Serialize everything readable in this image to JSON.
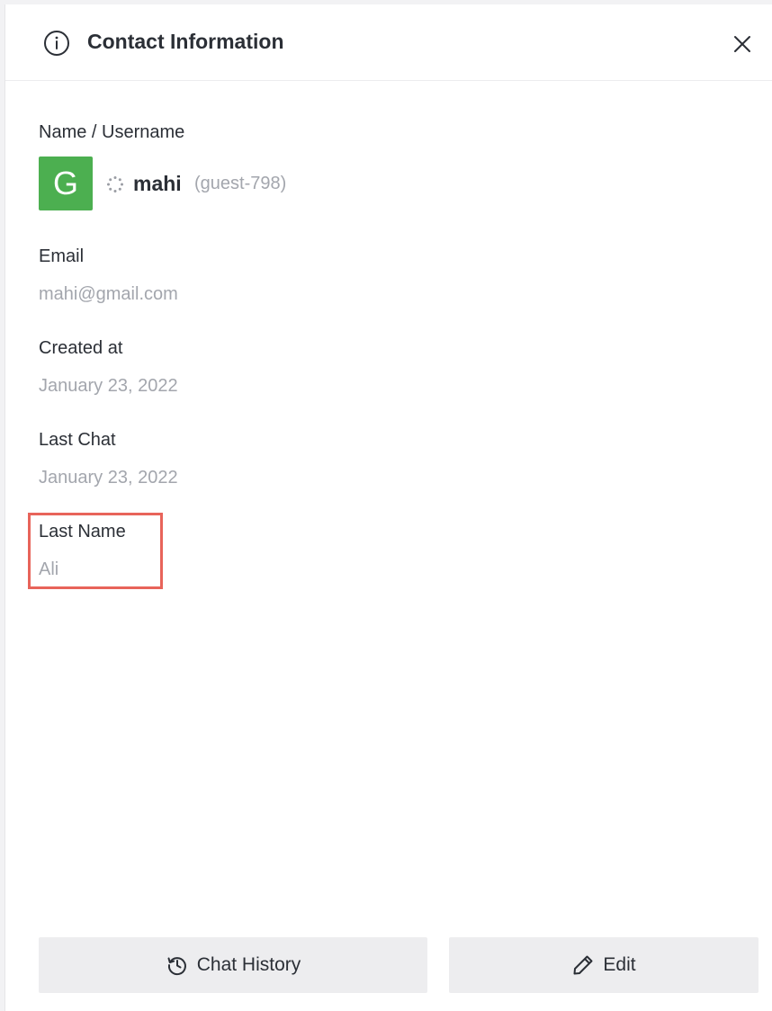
{
  "header": {
    "title": "Contact Information",
    "info_icon": "info-circle-icon",
    "close_icon": "close-icon"
  },
  "contact": {
    "name_label": "Name / Username",
    "avatar_letter": "G",
    "avatar_color": "#4caf50",
    "username": "mahi",
    "guest_id": "(guest-798)",
    "status_icon": "loading-spinner-icon",
    "email_label": "Email",
    "email_value": "mahi@gmail.com",
    "created_label": "Created at",
    "created_value": "January 23, 2022",
    "last_chat_label": "Last Chat",
    "last_chat_value": "January 23, 2022",
    "last_name_label": "Last Name",
    "last_name_value": "Ali",
    "highlight_color": "#e8645a"
  },
  "actions": {
    "chat_history_label": "Chat History",
    "chat_history_icon": "history-icon",
    "edit_label": "Edit",
    "edit_icon": "pencil-icon"
  }
}
